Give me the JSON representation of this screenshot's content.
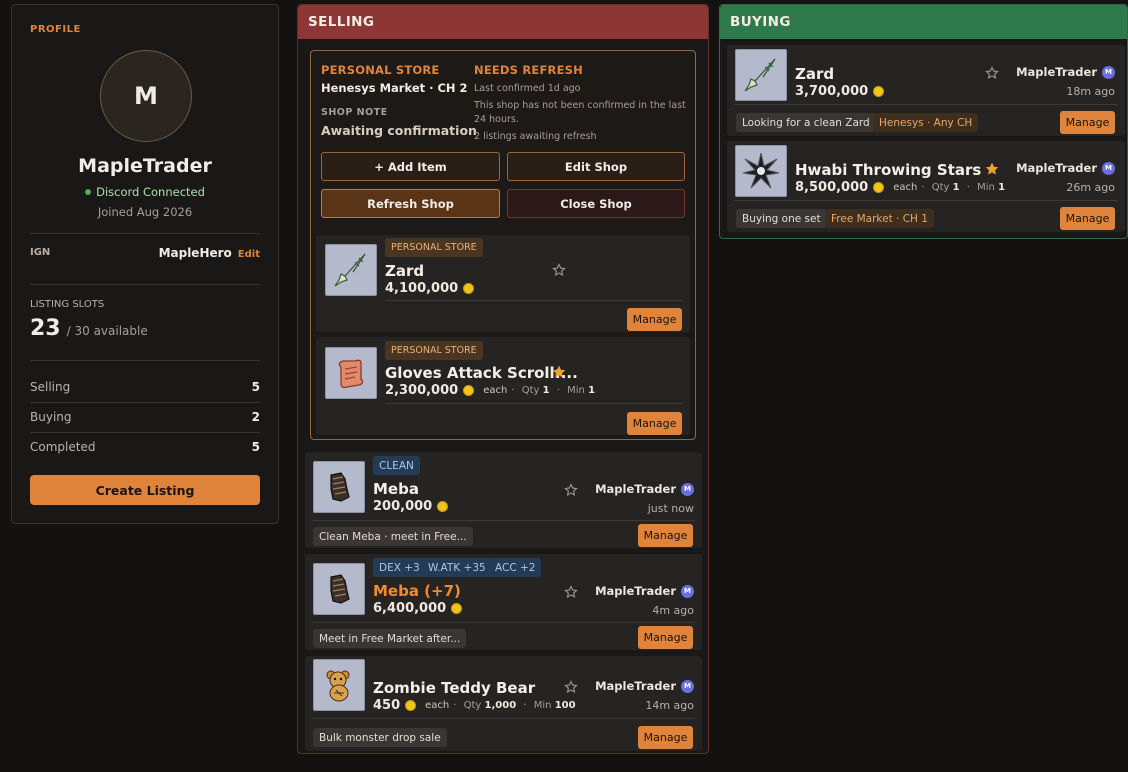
{
  "profile": {
    "header": "PROFILE",
    "avatar_letter": "M",
    "username": "MapleTrader",
    "discord_status": "Discord Connected",
    "joined": "Joined Aug 2026",
    "ign_label": "IGN",
    "ign_value": "MapleHero",
    "ign_edit": "Edit",
    "slots_label": "LISTING SLOTS",
    "slots_count": "23",
    "slots_available": "/ 30 available",
    "stats": [
      {
        "label": "Selling",
        "value": "5"
      },
      {
        "label": "Buying",
        "value": "2"
      },
      {
        "label": "Completed",
        "value": "5"
      }
    ],
    "create_button": "Create Listing"
  },
  "selling": {
    "header": "SELLING",
    "store": {
      "type_label": "PERSONAL STORE",
      "location": "Henesys Market · CH 2",
      "note_label": "SHOP NOTE",
      "note": "Awaiting confirmation",
      "status_label": "NEEDS REFRESH",
      "last_confirmed": "Last confirmed 1d ago",
      "warning": "This shop has not been confirmed in the last 24 hours.",
      "listings_status": "2 listings awaiting refresh",
      "buttons": {
        "add": "+ Add Item",
        "edit": "Edit Shop",
        "refresh": "Refresh Shop",
        "close": "Close Shop"
      },
      "items": [
        {
          "tag": "PERSONAL STORE",
          "name": "Zard",
          "price": "4,100,000",
          "starred": false,
          "manage": "Manage"
        },
        {
          "tag": "PERSONAL STORE",
          "name": "Gloves Attack Scroll:...",
          "price": "2,300,000",
          "each": "each",
          "qty_label": "Qty",
          "qty": "1",
          "min_label": "Min",
          "min": "1",
          "starred": true,
          "manage": "Manage"
        }
      ]
    },
    "listings": [
      {
        "tags": [
          "CLEAN"
        ],
        "name": "Meba",
        "price": "200,000",
        "seller": "MapleTrader",
        "time": "just now",
        "note": "Clean Meba · meet in Free...",
        "manage": "Manage",
        "starred": false
      },
      {
        "tags": [
          "DEX +3",
          "W.ATK +35",
          "ACC +2"
        ],
        "name": "Meba (+7)",
        "price": "6,400,000",
        "seller": "MapleTrader",
        "time": "4m ago",
        "note": "Meet in Free Market after...",
        "manage": "Manage",
        "starred": false
      },
      {
        "tags": [],
        "name": "Zombie Teddy Bear",
        "price": "450",
        "each": "each",
        "qty_label": "Qty",
        "qty": "1,000",
        "min_label": "Min",
        "min": "100",
        "seller": "MapleTrader",
        "time": "14m ago",
        "note": "Bulk monster drop sale",
        "manage": "Manage",
        "starred": false
      }
    ]
  },
  "buying": {
    "header": "BUYING",
    "listings": [
      {
        "name": "Zard",
        "price": "3,700,000",
        "seller": "MapleTrader",
        "time": "18m ago",
        "note": "Looking for a clean Zard",
        "location": "Henesys · Any CH",
        "manage": "Manage",
        "starred": false
      },
      {
        "name": "Hwabi Throwing Stars",
        "price": "8,500,000",
        "each": "each",
        "qty_label": "Qty",
        "qty": "1",
        "min_label": "Min",
        "min": "1",
        "seller": "MapleTrader",
        "time": "26m ago",
        "note": "Buying one set",
        "location": "Free Market · CH 1",
        "manage": "Manage",
        "starred": true
      }
    ]
  },
  "colors": {
    "accent": "#e0843c",
    "selling_header": "#8e3636",
    "buying_header": "#2e7a4d",
    "star_active": "#f0a030",
    "coin": "#f0c419"
  }
}
